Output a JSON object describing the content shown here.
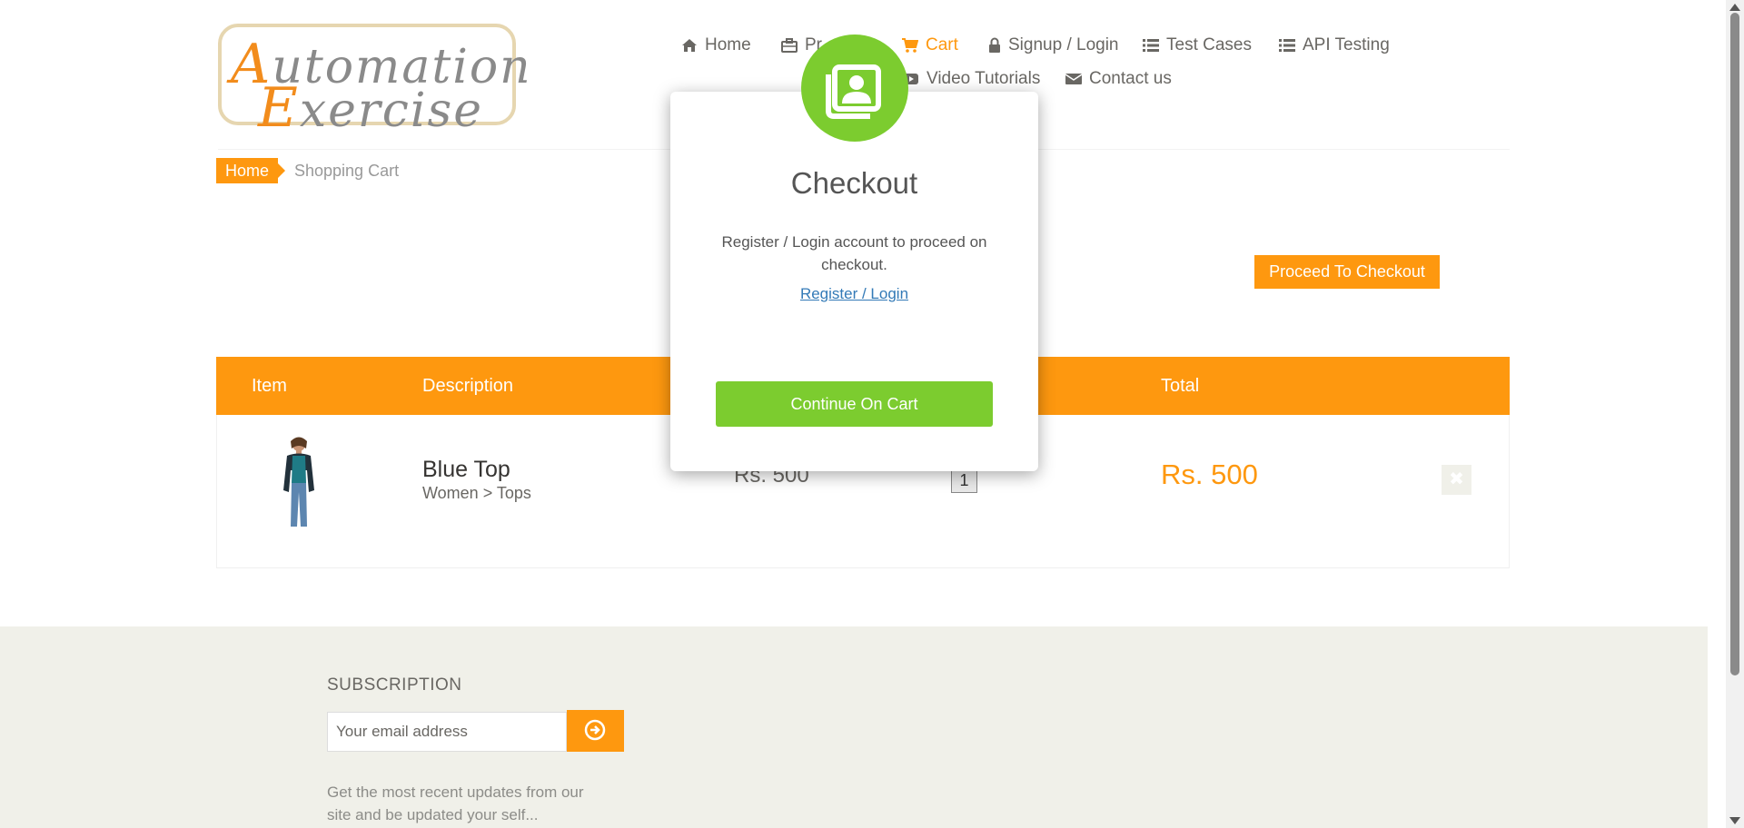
{
  "header": {
    "logo_line1": "Automation",
    "logo_line2": "Exercise",
    "nav": {
      "home": "Home",
      "products": "Pr",
      "cart": "Cart",
      "signup_login": "Signup / Login",
      "test_cases": "Test Cases",
      "api_testing": "API Testing",
      "video_tutorials": "Video Tutorials",
      "contact_us": "Contact us"
    }
  },
  "breadcrumb": {
    "home": "Home",
    "current": "Shopping Cart"
  },
  "cart": {
    "proceed_label": "Proceed To Checkout",
    "columns": {
      "item": "Item",
      "description": "Description",
      "total": "Total"
    },
    "items": [
      {
        "name": "Blue Top",
        "category": "Women > Tops",
        "price": "Rs. 500",
        "quantity": "1",
        "total": "Rs. 500",
        "delete_icon": "times-icon"
      }
    ]
  },
  "footer": {
    "subscription_title": "SUBSCRIPTION",
    "email_placeholder": "Your email address",
    "note": "Get the most recent updates from our site and be updated your self..."
  },
  "modal": {
    "icon": "contact-book-icon",
    "title": "Checkout",
    "message": "Register / Login account to proceed on checkout.",
    "link": "Register / Login",
    "button": "Continue On Cart"
  },
  "colors": {
    "accent": "#fe980f",
    "modal_green": "#7ccc2f",
    "link": "#337ab7"
  }
}
